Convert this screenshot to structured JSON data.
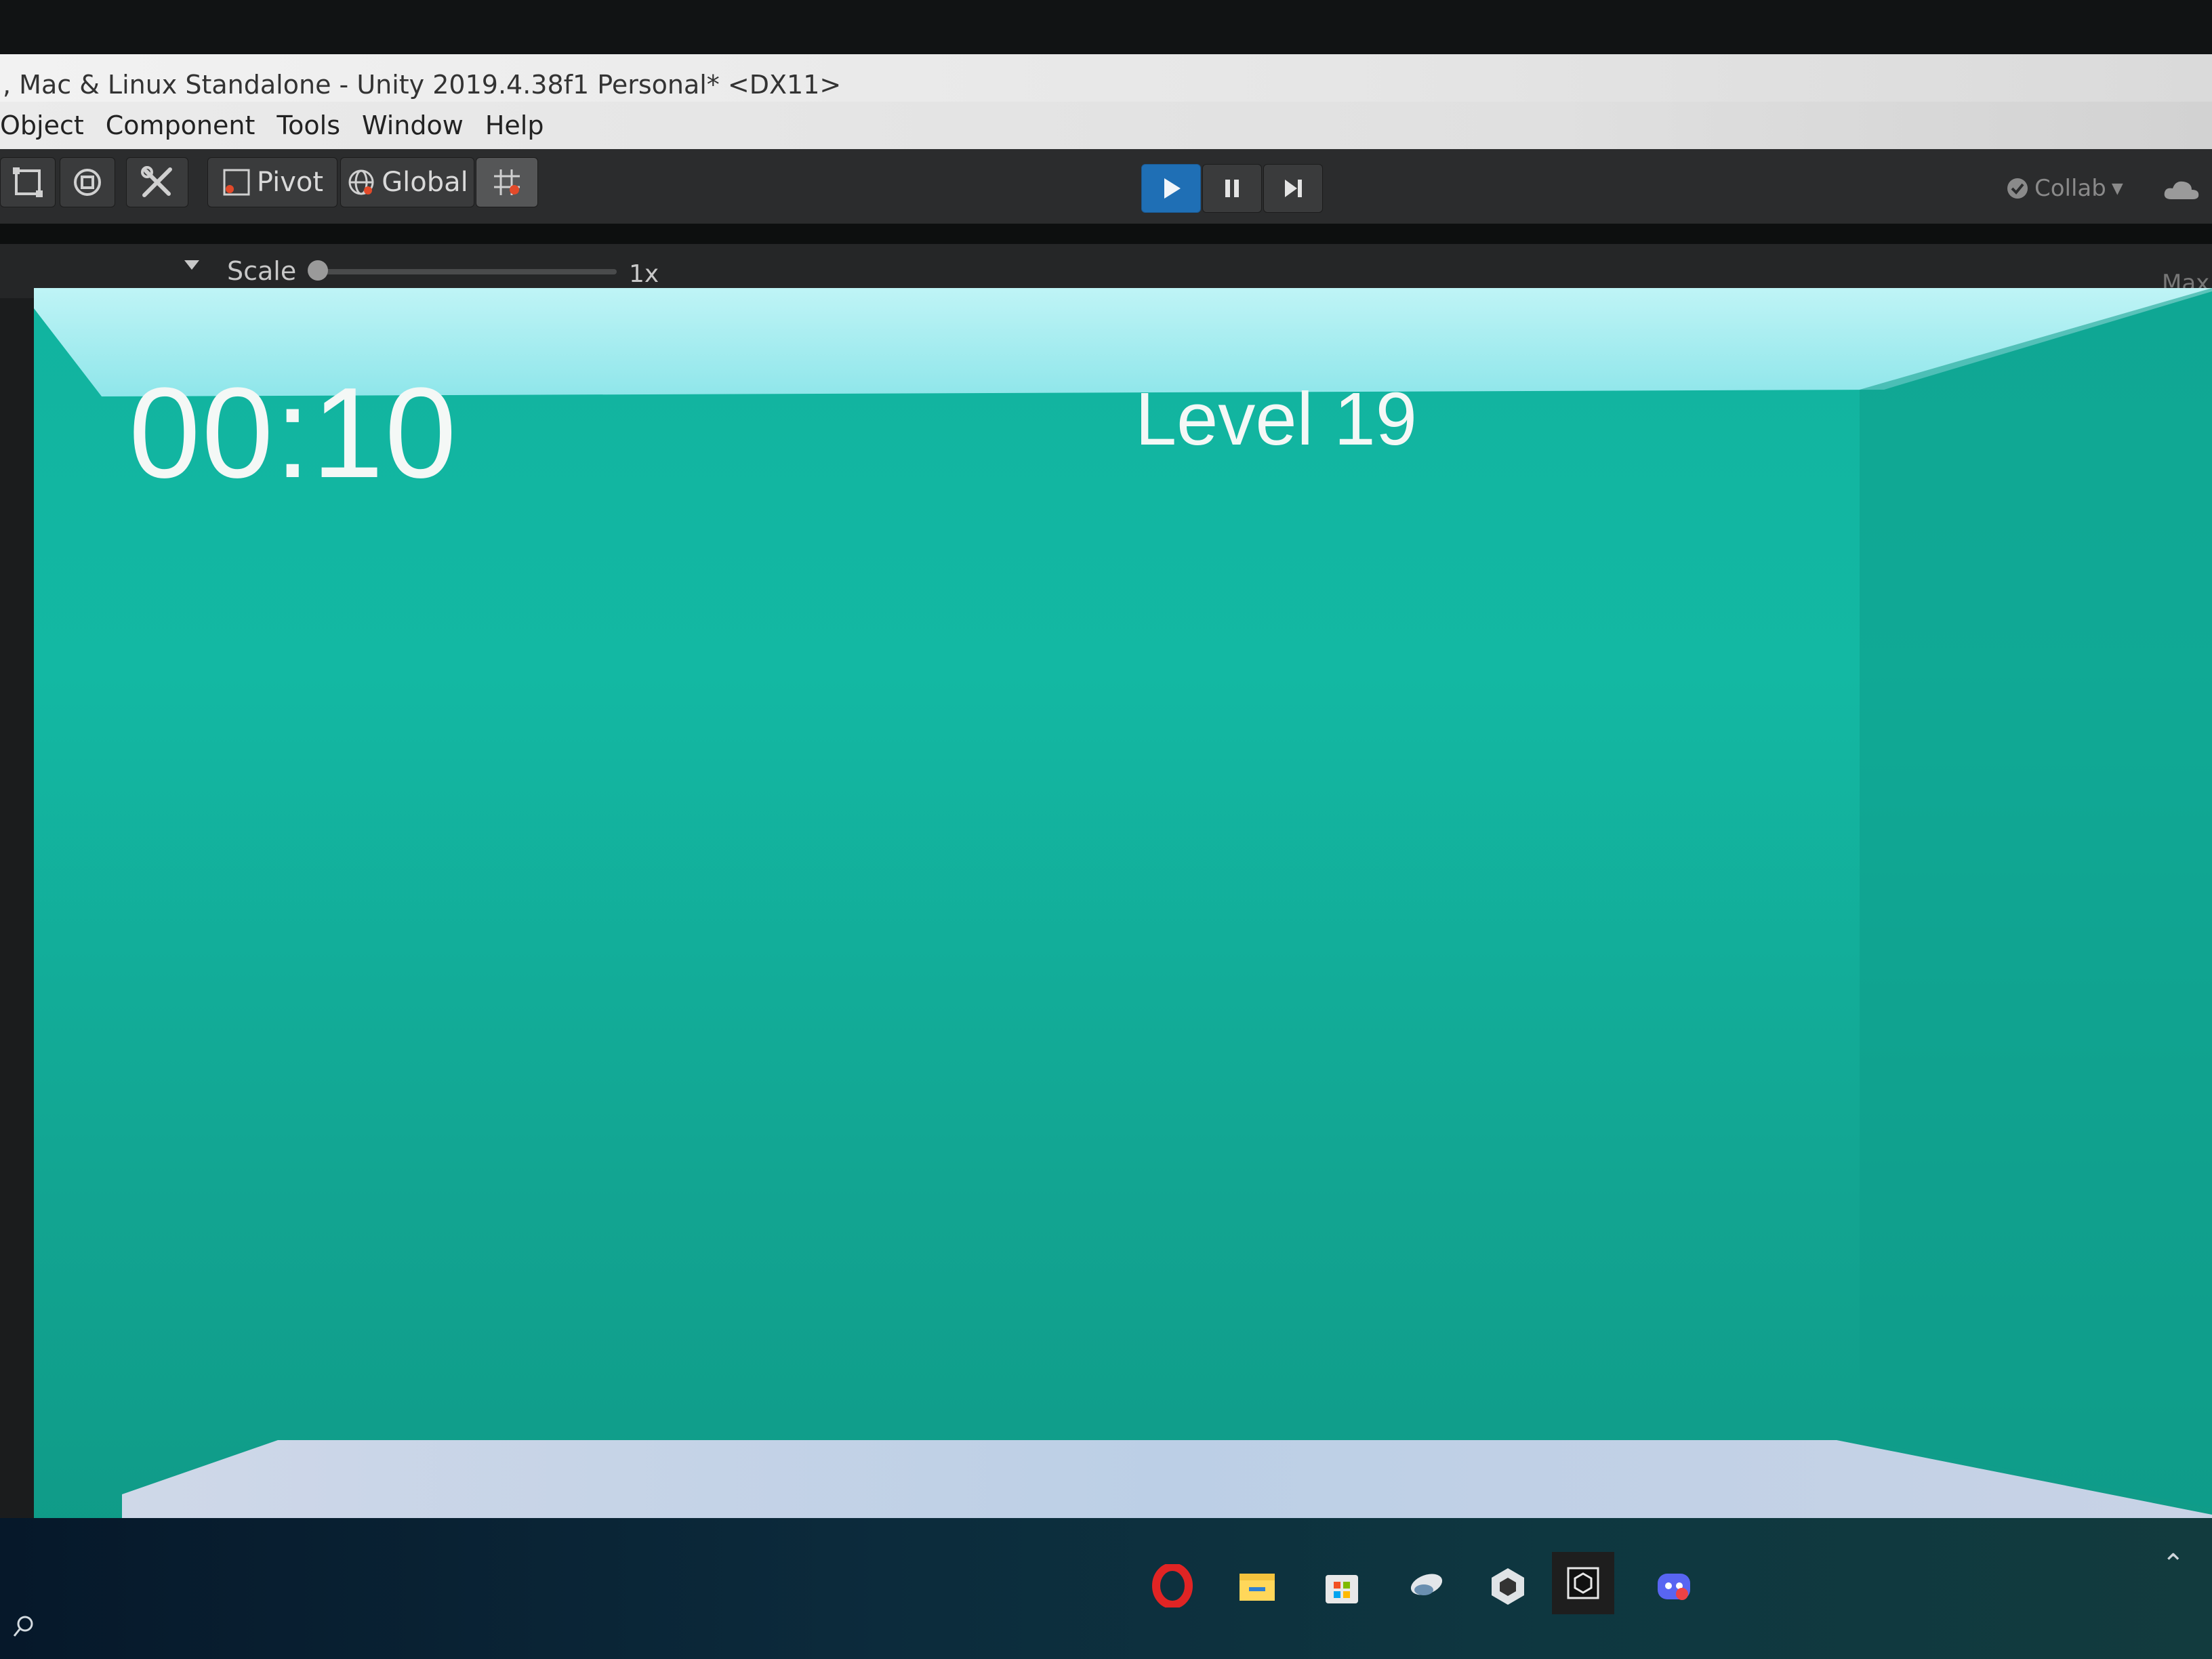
{
  "window": {
    "title": ", Mac & Linux Standalone - Unity 2019.4.38f1 Personal* <DX11>"
  },
  "menu": {
    "items": [
      "Object",
      "Component",
      "Tools",
      "Window",
      "Help"
    ]
  },
  "toolbar": {
    "pivot_label": "Pivot",
    "global_label": "Global",
    "collab_label": "Collab",
    "icons": [
      "rect-tool-icon",
      "transform-tool-icon",
      "custom-tool-icon",
      "snap-grid-icon",
      "play-icon",
      "pause-icon",
      "step-icon",
      "cloud-icon"
    ]
  },
  "game_view": {
    "scale_label": "Scale",
    "scale_value": "1x",
    "maximize_label": "Max",
    "scale_fraction": 0.0
  },
  "game": {
    "timer": "00:10",
    "level": "Level 19"
  },
  "taskbar": {
    "apps": [
      "opera-icon",
      "file-explorer-icon",
      "microsoft-store-icon",
      "app-icon",
      "unity-hub-icon",
      "unity-editor-icon",
      "discord-icon"
    ]
  },
  "colors": {
    "play_active": "#1f6fb5",
    "game_wall": "#12b29e",
    "ceiling": "#a9eef2",
    "floor": "#c4d6ea"
  }
}
